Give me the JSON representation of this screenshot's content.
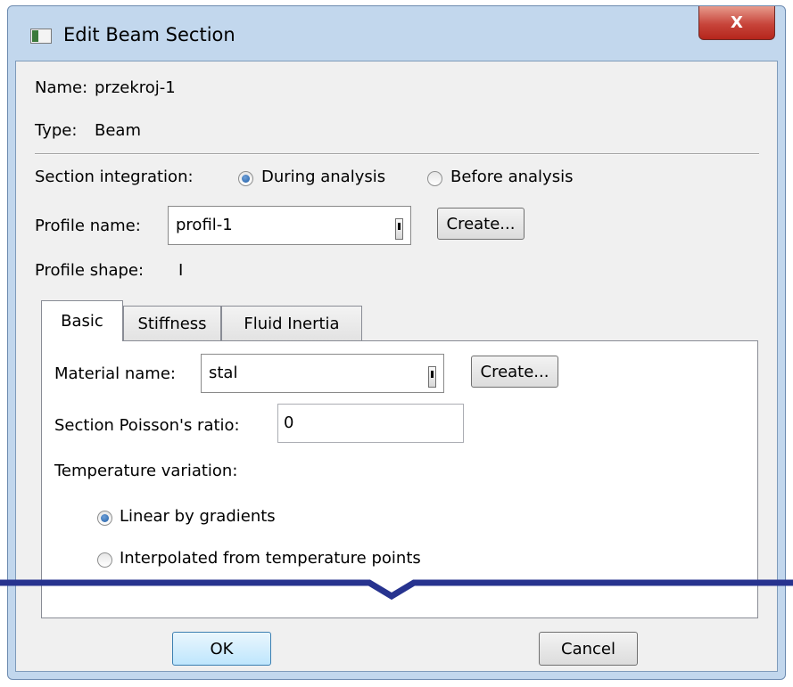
{
  "window": {
    "title": "Edit Beam Section",
    "close_label": "X"
  },
  "info": {
    "name_label": "Name:",
    "name_value": "przekroj-1",
    "type_label": "Type:",
    "type_value": "Beam"
  },
  "section_integration": {
    "label": "Section integration:",
    "options": [
      {
        "label": "During analysis",
        "selected": true
      },
      {
        "label": "Before analysis",
        "selected": false
      }
    ]
  },
  "profile": {
    "name_label": "Profile name:",
    "name_value": "profil-1",
    "create_label": "Create...",
    "shape_label": "Profile shape:",
    "shape_value": "I"
  },
  "tabs": [
    {
      "label": "Basic",
      "active": true
    },
    {
      "label": "Stiffness",
      "active": false
    },
    {
      "label": "Fluid Inertia",
      "active": false
    }
  ],
  "basic": {
    "material_label": "Material name:",
    "material_value": "stal",
    "material_create_label": "Create...",
    "poisson_label": "Section Poisson's ratio:",
    "poisson_value": "0",
    "temp_label": "Temperature variation:",
    "temp_options": [
      {
        "label": "Linear by gradients",
        "selected": true
      },
      {
        "label": "Interpolated from temperature points",
        "selected": false
      }
    ]
  },
  "buttons": {
    "ok": "OK",
    "cancel": "Cancel"
  },
  "colors": {
    "break_line": "#27338f",
    "window_frame": "#c2d7ed",
    "dialog_bg": "#f0f0f0"
  }
}
